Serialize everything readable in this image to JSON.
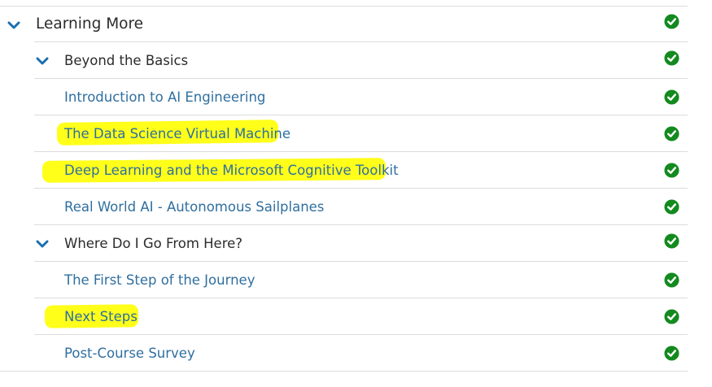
{
  "section": {
    "label": "Learning More",
    "status_icon": "check-circle-icon",
    "expand_icon": "chevron-down-icon"
  },
  "modules": [
    {
      "label": "Beyond the Basics",
      "status_icon": "check-circle-icon",
      "expand_icon": "chevron-down-icon",
      "units": [
        {
          "label": "Introduction to AI Engineering",
          "highlighted": false,
          "status_icon": "check-circle-icon"
        },
        {
          "label": "The Data Science Virtual Machine",
          "highlighted": true,
          "status_icon": "check-circle-icon"
        },
        {
          "label": "Deep Learning and the Microsoft Cognitive Toolkit",
          "highlighted": true,
          "status_icon": "check-circle-icon"
        },
        {
          "label": "Real World AI - Autonomous Sailplanes",
          "highlighted": false,
          "status_icon": "check-circle-icon"
        }
      ]
    },
    {
      "label": "Where Do I Go From Here?",
      "status_icon": "check-circle-icon",
      "expand_icon": "chevron-down-icon",
      "units": [
        {
          "label": "The First Step of the Journey",
          "highlighted": false,
          "status_icon": "check-circle-icon"
        },
        {
          "label": "Next Steps",
          "highlighted": true,
          "status_icon": "check-circle-icon"
        },
        {
          "label": "Post-Course Survey",
          "highlighted": false,
          "status_icon": "check-circle-icon"
        }
      ]
    }
  ],
  "colors": {
    "link": "#2f6f9f",
    "text": "#2b2b2b",
    "chevron": "#1a6fb0",
    "check": "#138a1e",
    "highlight": "#ffff1a",
    "divider": "#dcdcdc"
  }
}
